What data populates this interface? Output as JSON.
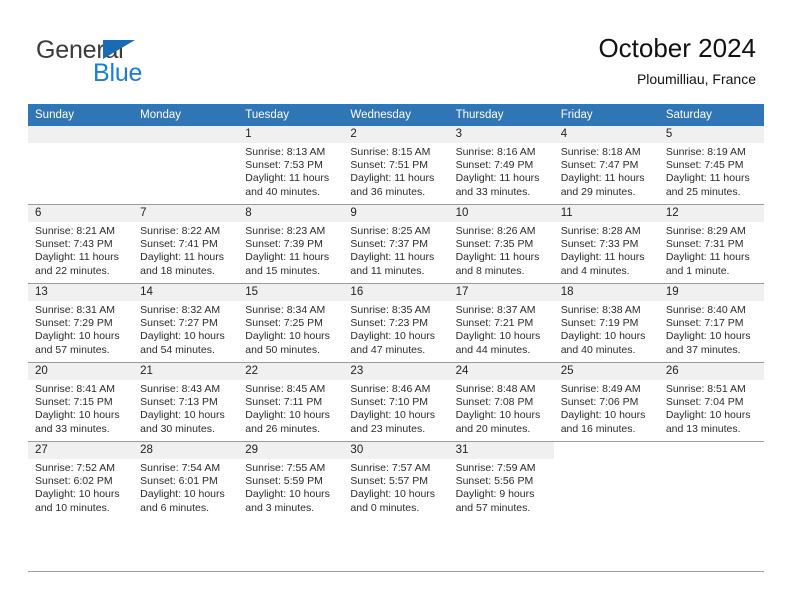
{
  "brand": {
    "name_part1": "General",
    "name_part2": "Blue",
    "triangle_icon": "blue-triangle-logo-mark",
    "colors": {
      "general_text": "#3b3b3b",
      "blue_text": "#1a7fd4",
      "triangle": "#1a6bb3"
    }
  },
  "header": {
    "title": "October 2024",
    "subtitle": "Ploumilliau, France"
  },
  "theme": {
    "header_row_bg": "#3075b5",
    "header_row_text": "#ffffff",
    "daynum_band_bg": "#f0f0f0",
    "cell_bg": "#ffffff",
    "rule_color": "#9c9c9c"
  },
  "calendar": {
    "weekday_headers": [
      "Sunday",
      "Monday",
      "Tuesday",
      "Wednesday",
      "Thursday",
      "Friday",
      "Saturday"
    ],
    "weeks": [
      [
        {
          "day": "",
          "empty": true,
          "blank": true,
          "sunrise": "",
          "sunset": "",
          "daylight1": "",
          "daylight2": ""
        },
        {
          "day": "",
          "empty": true,
          "blank": true,
          "sunrise": "",
          "sunset": "",
          "daylight1": "",
          "daylight2": ""
        },
        {
          "day": "1",
          "sunrise": "Sunrise: 8:13 AM",
          "sunset": "Sunset: 7:53 PM",
          "daylight1": "Daylight: 11 hours",
          "daylight2": "and 40 minutes."
        },
        {
          "day": "2",
          "sunrise": "Sunrise: 8:15 AM",
          "sunset": "Sunset: 7:51 PM",
          "daylight1": "Daylight: 11 hours",
          "daylight2": "and 36 minutes."
        },
        {
          "day": "3",
          "sunrise": "Sunrise: 8:16 AM",
          "sunset": "Sunset: 7:49 PM",
          "daylight1": "Daylight: 11 hours",
          "daylight2": "and 33 minutes."
        },
        {
          "day": "4",
          "sunrise": "Sunrise: 8:18 AM",
          "sunset": "Sunset: 7:47 PM",
          "daylight1": "Daylight: 11 hours",
          "daylight2": "and 29 minutes."
        },
        {
          "day": "5",
          "sunrise": "Sunrise: 8:19 AM",
          "sunset": "Sunset: 7:45 PM",
          "daylight1": "Daylight: 11 hours",
          "daylight2": "and 25 minutes."
        }
      ],
      [
        {
          "day": "6",
          "sunrise": "Sunrise: 8:21 AM",
          "sunset": "Sunset: 7:43 PM",
          "daylight1": "Daylight: 11 hours",
          "daylight2": "and 22 minutes."
        },
        {
          "day": "7",
          "sunrise": "Sunrise: 8:22 AM",
          "sunset": "Sunset: 7:41 PM",
          "daylight1": "Daylight: 11 hours",
          "daylight2": "and 18 minutes."
        },
        {
          "day": "8",
          "sunrise": "Sunrise: 8:23 AM",
          "sunset": "Sunset: 7:39 PM",
          "daylight1": "Daylight: 11 hours",
          "daylight2": "and 15 minutes."
        },
        {
          "day": "9",
          "sunrise": "Sunrise: 8:25 AM",
          "sunset": "Sunset: 7:37 PM",
          "daylight1": "Daylight: 11 hours",
          "daylight2": "and 11 minutes."
        },
        {
          "day": "10",
          "sunrise": "Sunrise: 8:26 AM",
          "sunset": "Sunset: 7:35 PM",
          "daylight1": "Daylight: 11 hours",
          "daylight2": "and 8 minutes."
        },
        {
          "day": "11",
          "sunrise": "Sunrise: 8:28 AM",
          "sunset": "Sunset: 7:33 PM",
          "daylight1": "Daylight: 11 hours",
          "daylight2": "and 4 minutes."
        },
        {
          "day": "12",
          "sunrise": "Sunrise: 8:29 AM",
          "sunset": "Sunset: 7:31 PM",
          "daylight1": "Daylight: 11 hours",
          "daylight2": "and 1 minute."
        }
      ],
      [
        {
          "day": "13",
          "sunrise": "Sunrise: 8:31 AM",
          "sunset": "Sunset: 7:29 PM",
          "daylight1": "Daylight: 10 hours",
          "daylight2": "and 57 minutes."
        },
        {
          "day": "14",
          "sunrise": "Sunrise: 8:32 AM",
          "sunset": "Sunset: 7:27 PM",
          "daylight1": "Daylight: 10 hours",
          "daylight2": "and 54 minutes."
        },
        {
          "day": "15",
          "sunrise": "Sunrise: 8:34 AM",
          "sunset": "Sunset: 7:25 PM",
          "daylight1": "Daylight: 10 hours",
          "daylight2": "and 50 minutes."
        },
        {
          "day": "16",
          "sunrise": "Sunrise: 8:35 AM",
          "sunset": "Sunset: 7:23 PM",
          "daylight1": "Daylight: 10 hours",
          "daylight2": "and 47 minutes."
        },
        {
          "day": "17",
          "sunrise": "Sunrise: 8:37 AM",
          "sunset": "Sunset: 7:21 PM",
          "daylight1": "Daylight: 10 hours",
          "daylight2": "and 44 minutes."
        },
        {
          "day": "18",
          "sunrise": "Sunrise: 8:38 AM",
          "sunset": "Sunset: 7:19 PM",
          "daylight1": "Daylight: 10 hours",
          "daylight2": "and 40 minutes."
        },
        {
          "day": "19",
          "sunrise": "Sunrise: 8:40 AM",
          "sunset": "Sunset: 7:17 PM",
          "daylight1": "Daylight: 10 hours",
          "daylight2": "and 37 minutes."
        }
      ],
      [
        {
          "day": "20",
          "sunrise": "Sunrise: 8:41 AM",
          "sunset": "Sunset: 7:15 PM",
          "daylight1": "Daylight: 10 hours",
          "daylight2": "and 33 minutes."
        },
        {
          "day": "21",
          "sunrise": "Sunrise: 8:43 AM",
          "sunset": "Sunset: 7:13 PM",
          "daylight1": "Daylight: 10 hours",
          "daylight2": "and 30 minutes."
        },
        {
          "day": "22",
          "sunrise": "Sunrise: 8:45 AM",
          "sunset": "Sunset: 7:11 PM",
          "daylight1": "Daylight: 10 hours",
          "daylight2": "and 26 minutes."
        },
        {
          "day": "23",
          "sunrise": "Sunrise: 8:46 AM",
          "sunset": "Sunset: 7:10 PM",
          "daylight1": "Daylight: 10 hours",
          "daylight2": "and 23 minutes."
        },
        {
          "day": "24",
          "sunrise": "Sunrise: 8:48 AM",
          "sunset": "Sunset: 7:08 PM",
          "daylight1": "Daylight: 10 hours",
          "daylight2": "and 20 minutes."
        },
        {
          "day": "25",
          "sunrise": "Sunrise: 8:49 AM",
          "sunset": "Sunset: 7:06 PM",
          "daylight1": "Daylight: 10 hours",
          "daylight2": "and 16 minutes."
        },
        {
          "day": "26",
          "sunrise": "Sunrise: 8:51 AM",
          "sunset": "Sunset: 7:04 PM",
          "daylight1": "Daylight: 10 hours",
          "daylight2": "and 13 minutes."
        }
      ],
      [
        {
          "day": "27",
          "sunrise": "Sunrise: 7:52 AM",
          "sunset": "Sunset: 6:02 PM",
          "daylight1": "Daylight: 10 hours",
          "daylight2": "and 10 minutes."
        },
        {
          "day": "28",
          "sunrise": "Sunrise: 7:54 AM",
          "sunset": "Sunset: 6:01 PM",
          "daylight1": "Daylight: 10 hours",
          "daylight2": "and 6 minutes."
        },
        {
          "day": "29",
          "sunrise": "Sunrise: 7:55 AM",
          "sunset": "Sunset: 5:59 PM",
          "daylight1": "Daylight: 10 hours",
          "daylight2": "and 3 minutes."
        },
        {
          "day": "30",
          "sunrise": "Sunrise: 7:57 AM",
          "sunset": "Sunset: 5:57 PM",
          "daylight1": "Daylight: 10 hours",
          "daylight2": "and 0 minutes."
        },
        {
          "day": "31",
          "sunrise": "Sunrise: 7:59 AM",
          "sunset": "Sunset: 5:56 PM",
          "daylight1": "Daylight: 9 hours",
          "daylight2": "and 57 minutes."
        },
        {
          "day": "",
          "empty": true,
          "blank": true,
          "sunrise": "",
          "sunset": "",
          "daylight1": "",
          "daylight2": ""
        },
        {
          "day": "",
          "empty": true,
          "blank": true,
          "sunrise": "",
          "sunset": "",
          "daylight1": "",
          "daylight2": ""
        }
      ]
    ]
  }
}
